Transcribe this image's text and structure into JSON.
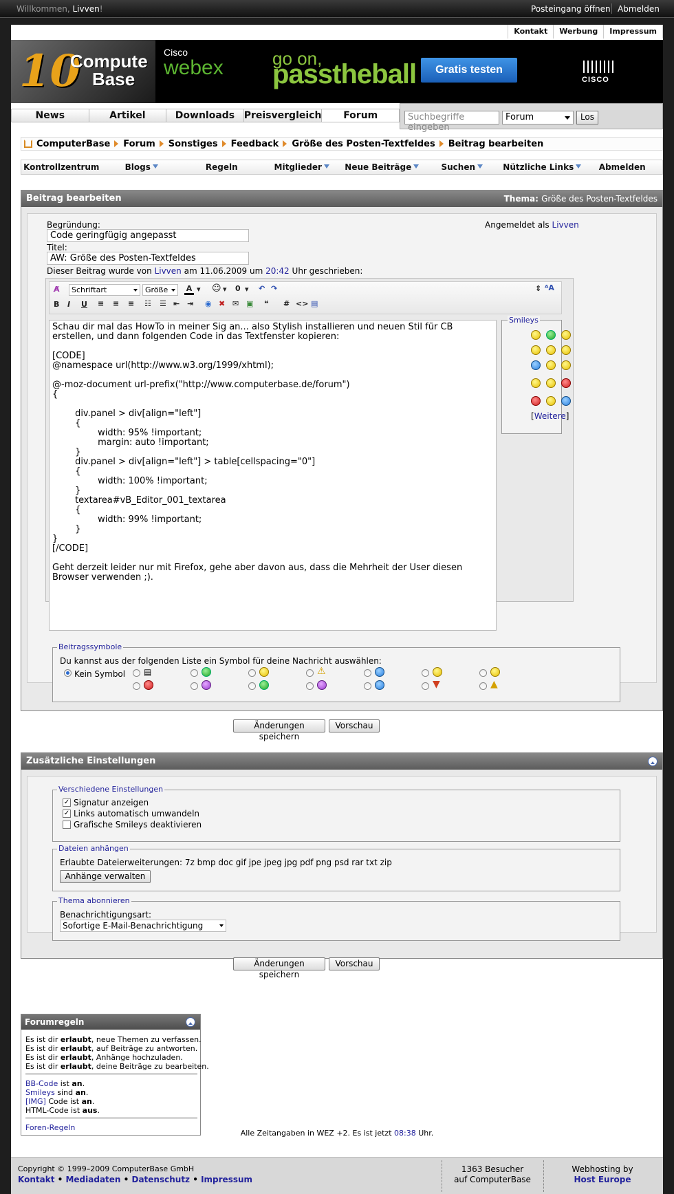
{
  "topbar": {
    "welcome_prefix": "Willkommen,",
    "user": "Livven",
    "welcome_suffix": "!",
    "inbox": "Posteingang öffnen",
    "logout": "Abmelden"
  },
  "toplinks": [
    "Kontakt",
    "Werbung",
    "Impressum"
  ],
  "logo": {
    "ten": "10",
    "line1": "Compute",
    "line2": "Base"
  },
  "banner": {
    "brand_small": "Cisco",
    "brand": "webex",
    "slogan1": "go on,",
    "slogan2": "passtheball",
    "cta": "Gratis testen",
    "cisco": "CISCO"
  },
  "nav": [
    "News",
    "Artikel",
    "Downloads",
    "Preisvergleich",
    "Forum"
  ],
  "search": {
    "placeholder": "Suchbegriffe eingeben",
    "scope": "Forum",
    "button": "Los"
  },
  "breadcrumb": [
    "ComputerBase",
    "Forum",
    "Sonstiges",
    "Feedback",
    "Größe des Posten-Textfeldes",
    "Beitrag bearbeiten"
  ],
  "subnav": [
    {
      "label": "Kontrollzentrum",
      "dd": false
    },
    {
      "label": "Blogs",
      "dd": true
    },
    {
      "label": "Regeln",
      "dd": false
    },
    {
      "label": "Mitglieder",
      "dd": true
    },
    {
      "label": "Neue Beiträge",
      "dd": true
    },
    {
      "label": "Suchen",
      "dd": true
    },
    {
      "label": "Nützliche Links",
      "dd": true
    },
    {
      "label": "Abmelden",
      "dd": false
    }
  ],
  "edit": {
    "title": "Beitrag bearbeiten",
    "thema_label": "Thema:",
    "thema_value": "Größe des Posten-Textfeldes",
    "reason_label": "Begründung:",
    "reason_value": "Code geringfügig angepasst",
    "logged_in_prefix": "Angemeldet als",
    "logged_in_user": "Livven",
    "title_label": "Titel:",
    "title_value": "AW: Größe des Posten-Textfeldes",
    "info_prefix": "Dieser Beitrag wurde von",
    "info_user": "Livven",
    "info_mid": "am 11.06.2009 um",
    "info_time": "20:42",
    "info_suffix": "Uhr geschrieben:",
    "font_select": "Schriftart",
    "size_select": "Größe",
    "message": "Schau dir mal das HowTo in meiner Sig an... also Stylish installieren und neuen Stil für CB erstellen, und dann folgenden Code in das Textfenster kopieren:\n\n[CODE]\n@namespace url(http://www.w3.org/1999/xhtml);\n\n@-moz-document url-prefix(\"http://www.computerbase.de/forum\")\n{\n\n        div.panel > div[align=\"left\"]\n        {\n                width: 95% !important;\n                margin: auto !important;\n        }\n        div.panel > div[align=\"left\"] > table[cellspacing=\"0\"]\n        {\n                width: 100% !important;\n        }\n        textarea#vB_Editor_001_textarea\n        {\n                width: 99% !important;\n        }\n}\n[/CODE]\n\nGeht derzeit leider nur mit Firefox, gehe aber davon aus, dass die Mehrheit der User diesen Browser verwenden ;).",
    "smileys_legend": "Smileys",
    "smileys_more": "Weitere",
    "icons_legend": "Beitragssymbole",
    "icons_text": "Du kannst aus der folgenden Liste ein Symbol für deine Nachricht auswählen:",
    "no_icon": "Kein Symbol",
    "save": "Änderungen speichern",
    "preview": "Vorschau"
  },
  "extra": {
    "title": "Zusätzliche Einstellungen",
    "misc_legend": "Verschiedene Einstellungen",
    "sig": "Signatur anzeigen",
    "links": "Links automatisch umwandeln",
    "smileys_off": "Grafische Smileys deaktivieren",
    "attach_legend": "Dateien anhängen",
    "attach_text": "Erlaubte Dateierweiterungen: 7z bmp doc gif jpe jpeg jpg pdf png psd rar txt zip",
    "attach_button": "Anhänge verwalten",
    "sub_legend": "Thema abonnieren",
    "sub_label": "Benachrichtigungsart:",
    "sub_value": "Sofortige E-Mail-Benachrichtigung",
    "save": "Änderungen speichern",
    "preview": "Vorschau"
  },
  "rules": {
    "title": "Forumregeln",
    "p1": "Es ist dir",
    "allowed": "erlaubt",
    "l1": ", neue Themen zu verfassen.",
    "l2": ", auf Beiträge zu antworten.",
    "l3": ", Anhänge hochzuladen.",
    "l4": ", deine Beiträge zu bearbeiten.",
    "bb": "BB-Code",
    "bb_s": "ist",
    "bb_v": "an",
    "sm": "Smileys",
    "sm_s": "sind",
    "sm_v": "an",
    "img": "[IMG]",
    "img_s": "Code ist",
    "img_v": "an",
    "html": "HTML-Code ist",
    "html_v": "aus",
    "link": "Foren-Regeln"
  },
  "time": {
    "prefix": "Alle Zeitangaben in WEZ +2. Es ist jetzt",
    "time": "08:38",
    "suffix": "Uhr."
  },
  "footer": {
    "copy": "Copyright © 1999–2009 ComputerBase GmbH",
    "links": [
      "Kontakt",
      "Mediadaten",
      "Datenschutz",
      "Impressum"
    ],
    "visitors1": "1363 Besucher",
    "visitors2": "auf ComputerBase",
    "hosting1": "Webhosting by",
    "hosting2": "Host Europe"
  }
}
